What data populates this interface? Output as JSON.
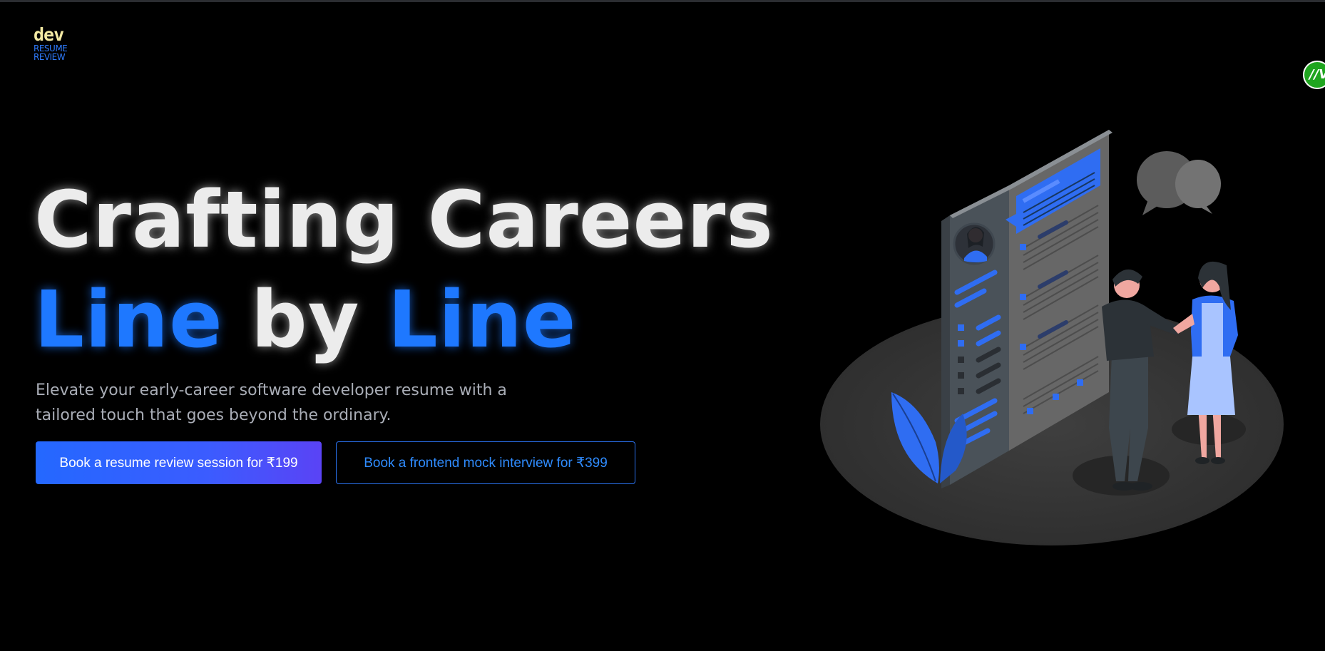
{
  "logo": {
    "word": "dev",
    "line1": "RESUME",
    "line2": "REVIEW"
  },
  "avatar": {
    "initials": "//V"
  },
  "hero": {
    "headline_line1": "Crafting Careers",
    "headline_line2_part1": "Line",
    "headline_line2_part2": "by",
    "headline_line2_part3": "Line",
    "subtitle": "Elevate your early-career software developer resume with a tailored touch that goes beyond the ordinary."
  },
  "buttons": {
    "resume_review": "Book a resume review session for ₹199",
    "mock_interview": "Book a frontend mock interview for ₹399"
  },
  "colors": {
    "background": "#000000",
    "accent_blue": "#1e78ff",
    "headline_white": "#ececec",
    "subtitle_gray": "#a9adb6",
    "logo_yellow": "#f3e9a3"
  },
  "icons": {
    "illustration": "resume-handshake-illustration"
  }
}
